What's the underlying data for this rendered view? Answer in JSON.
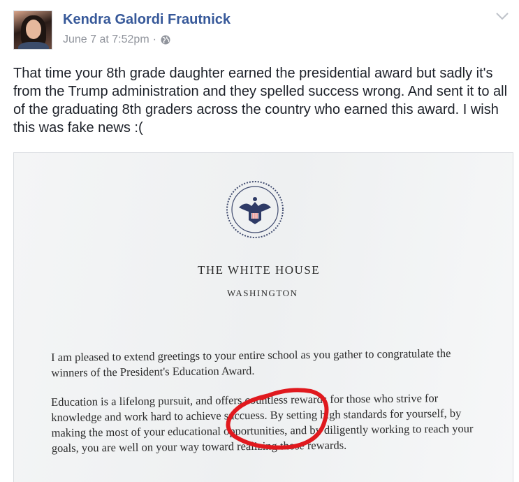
{
  "post": {
    "author": "Kendra Galordi Frautnick",
    "timestamp": "June 7 at 7:52pm",
    "separator": "·",
    "privacy_icon": "globe-icon",
    "menu_icon": "chevron-down-icon",
    "text": "That time your 8th grade daughter earned the presidential award but sadly it's from the Trump administration and they spelled success wrong. And sent it to all of the graduating 8th graders across the country who earned this award. I wish this was fake news :("
  },
  "photo": {
    "letterhead_title": "THE WHITE HOUSE",
    "letterhead_subtitle": "WASHINGTON",
    "paragraph_1": "I am pleased to extend greetings to your entire school as you gather to congratulate the winners of the President's Education Award.",
    "paragraph_2": "Education is a lifelong pursuit, and offers countless rewards for those who strive for knowledge and work hard to achieve succuess. By setting high standards for yourself, by making the most of your educational opportunities, and by diligently working to reach your goals, you are well on your way toward realizing those rewards.",
    "annotation_color": "#e0191e"
  },
  "colors": {
    "author_link": "#365899",
    "meta_text": "#90949c",
    "body_text": "#1d2129"
  }
}
